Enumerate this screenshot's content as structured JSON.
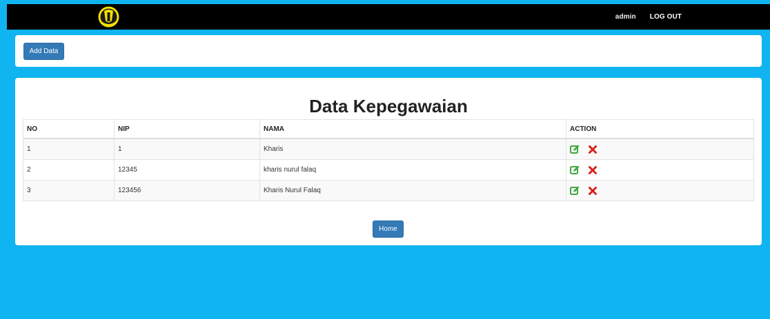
{
  "navbar": {
    "user_label": "admin",
    "logout_label": "LOG OUT"
  },
  "toolbar": {
    "add_label": "Add Data"
  },
  "main": {
    "title": "Data Kepegawaian",
    "table": {
      "headers": [
        "NO",
        "NIP",
        "NAMA",
        "ACTION"
      ],
      "rows": [
        {
          "no": "1",
          "nip": "1",
          "nama": "Kharis"
        },
        {
          "no": "2",
          "nip": "12345",
          "nama": "kharis nurul falaq"
        },
        {
          "no": "3",
          "nip": "123456",
          "nama": "Kharis Nurul Falaq"
        }
      ]
    },
    "home_label": "Home"
  },
  "colors": {
    "background": "#0fb4f0",
    "navbar": "#000000",
    "button": "#337ab7",
    "edit_icon": "#3fa63f",
    "delete_icon": "#d9201b",
    "logo": "#f5e000"
  },
  "icons": {
    "edit": "edit-icon",
    "delete": "delete-icon",
    "logo": "university-logo"
  }
}
